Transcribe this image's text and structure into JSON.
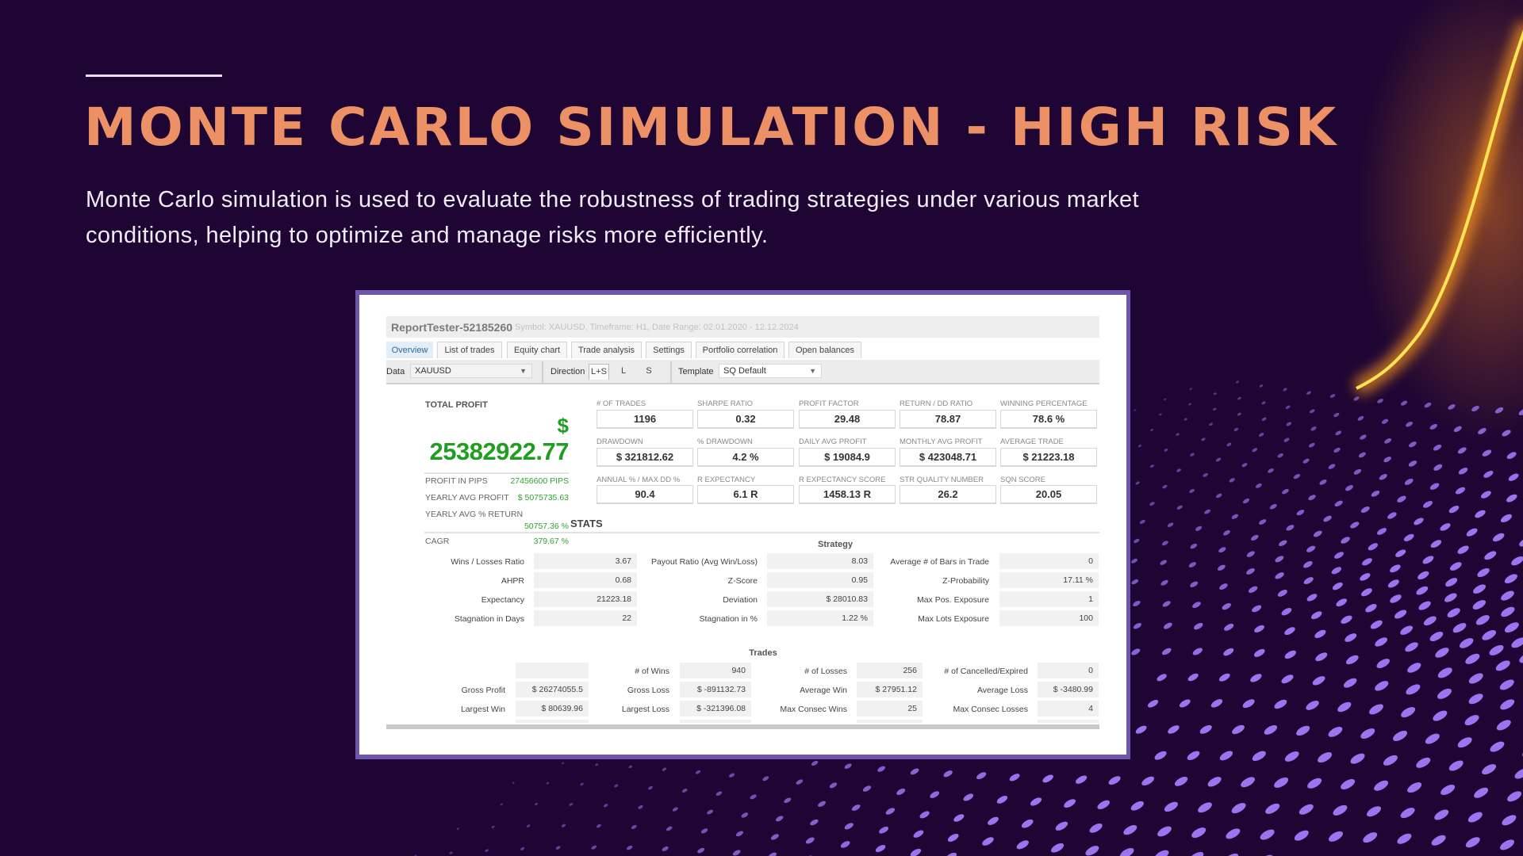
{
  "slide": {
    "title": "MONTE CARLO SIMULATION - HIGH RISK",
    "subtitle": "Monte Carlo simulation is used to evaluate the robustness of trading strategies under various market conditions, helping to optimize and manage risks more efficiently.",
    "colors": {
      "background": "#1e0533",
      "title": "#ec9166",
      "dots": "#9b74f0",
      "glow": "#ffc21a",
      "frame": "#6e56a8"
    }
  },
  "report": {
    "title": "ReportTester-52185260",
    "subtitle": "Symbol: XAUUSD, Timeframe: H1, Date Range: 02.01.2020 - 12.12.2024",
    "tabs": [
      {
        "label": "Overview",
        "active": true
      },
      {
        "label": "List of trades"
      },
      {
        "label": "Equity chart"
      },
      {
        "label": "Trade analysis"
      },
      {
        "label": "Settings"
      },
      {
        "label": "Portfolio correlation"
      },
      {
        "label": "Open balances"
      }
    ],
    "toolbar": {
      "data_label": "Data",
      "data_value": "XAUUSD",
      "direction_label": "Direction",
      "directions": [
        "L+S",
        "L",
        "S"
      ],
      "direction_selected": "L+S",
      "template_label": "Template",
      "template_value": "SQ Default"
    },
    "total_profit": {
      "label": "TOTAL PROFIT",
      "currency": "$",
      "value": "25382922.77",
      "rows": [
        {
          "label": "PROFIT IN PIPS",
          "value": "27456600 PIPS"
        },
        {
          "label": "YEARLY AVG PROFIT",
          "value": "$ 5075735.63"
        },
        {
          "label": "YEARLY AVG % RETURN",
          "value": "50757.36 %"
        },
        {
          "label": "CAGR",
          "value": "379.67 %"
        }
      ],
      "stats_label": "STATS"
    },
    "metrics": [
      {
        "label": "# OF TRADES",
        "value": "1196"
      },
      {
        "label": "SHARPE RATIO",
        "value": "0.32"
      },
      {
        "label": "PROFIT FACTOR",
        "value": "29.48"
      },
      {
        "label": "RETURN / DD RATIO",
        "value": "78.87"
      },
      {
        "label": "WINNING PERCENTAGE",
        "value": "78.6 %"
      },
      {
        "label": "DRAWDOWN",
        "value": "$ 321812.62"
      },
      {
        "label": "% DRAWDOWN",
        "value": "4.2 %"
      },
      {
        "label": "DAILY AVG PROFIT",
        "value": "$ 19084.9"
      },
      {
        "label": "MONTHLY AVG PROFIT",
        "value": "$ 423048.71"
      },
      {
        "label": "AVERAGE TRADE",
        "value": "$ 21223.18"
      },
      {
        "label": "ANNUAL % / MAX DD %",
        "value": "90.4"
      },
      {
        "label": "R EXPECTANCY",
        "value": "6.1 R"
      },
      {
        "label": "R EXPECTANCY SCORE",
        "value": "1458.13 R"
      },
      {
        "label": "STR QUALITY NUMBER",
        "value": "26.2"
      },
      {
        "label": "SQN SCORE",
        "value": "20.05"
      }
    ],
    "strategy": {
      "heading": "Strategy",
      "rows": [
        [
          {
            "label": "Wins / Losses Ratio",
            "value": "3.67"
          },
          {
            "label": "Payout Ratio (Avg Win/Loss)",
            "value": "8.03"
          },
          {
            "label": "Average # of Bars in Trade",
            "value": "0"
          }
        ],
        [
          {
            "label": "AHPR",
            "value": "0.68"
          },
          {
            "label": "Z-Score",
            "value": "0.95"
          },
          {
            "label": "Z-Probability",
            "value": "17.11 %"
          }
        ],
        [
          {
            "label": "Expectancy",
            "value": "21223.18"
          },
          {
            "label": "Deviation",
            "value": "$ 28010.83"
          },
          {
            "label": "Max Pos. Exposure",
            "value": "1"
          }
        ],
        [
          {
            "label": "Stagnation in Days",
            "value": "22"
          },
          {
            "label": "Stagnation in %",
            "value": "1.22 %"
          },
          {
            "label": "Max Lots Exposure",
            "value": "100"
          }
        ]
      ]
    },
    "trades": {
      "heading": "Trades",
      "rows": [
        [
          {
            "label": "",
            "value": ""
          },
          {
            "label": "# of Wins",
            "value": "940"
          },
          {
            "label": "# of Losses",
            "value": "256"
          },
          {
            "label": "# of Cancelled/Expired",
            "value": "0"
          }
        ],
        [
          {
            "label": "Gross Profit",
            "value": "$ 26274055.5"
          },
          {
            "label": "Gross Loss",
            "value": "$ -891132.73"
          },
          {
            "label": "Average Win",
            "value": "$ 27951.12"
          },
          {
            "label": "Average Loss",
            "value": "$ -3480.99"
          }
        ],
        [
          {
            "label": "Largest Win",
            "value": "$ 80639.96"
          },
          {
            "label": "Largest Loss",
            "value": "$ -321396.08"
          },
          {
            "label": "Max Consec Wins",
            "value": "25"
          },
          {
            "label": "Max Consec Losses",
            "value": "4"
          }
        ]
      ]
    }
  }
}
